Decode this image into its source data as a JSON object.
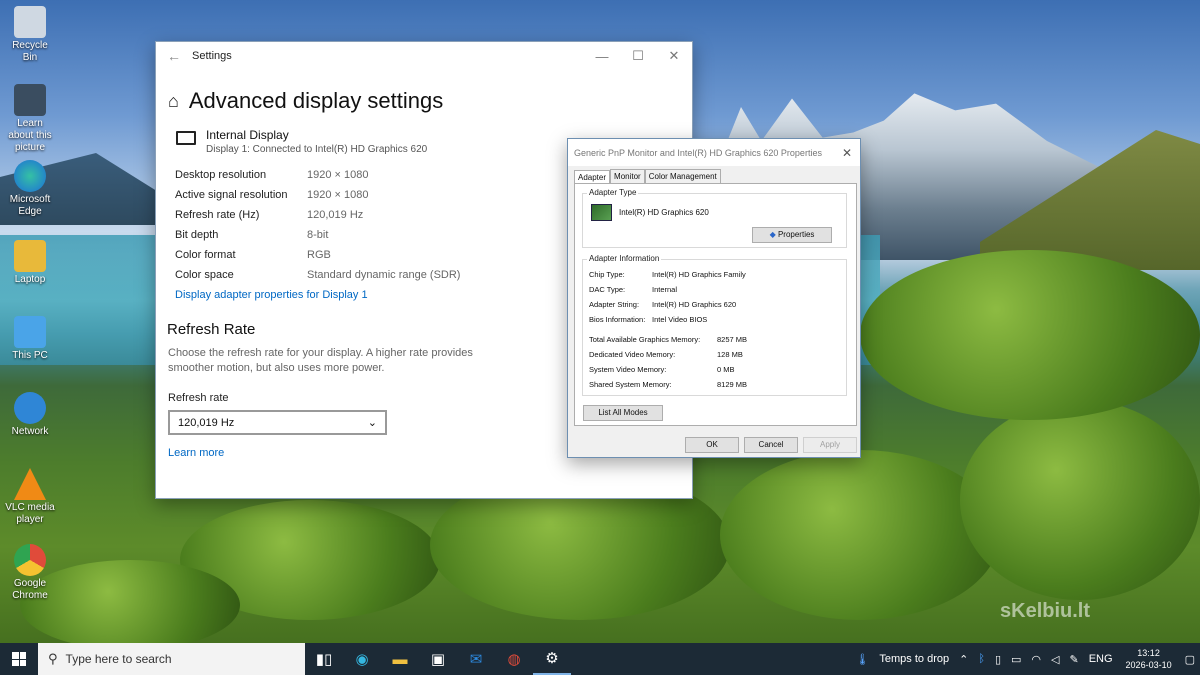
{
  "desktop": {
    "icons": [
      {
        "label": "Recycle Bin",
        "icon": "recycle-bin-icon",
        "color": "#cfd8e2"
      },
      {
        "label": "Learn about this picture",
        "icon": "learn-picture-icon",
        "color": "#3a4d60"
      },
      {
        "label": "Microsoft Edge",
        "icon": "edge-icon",
        "color": "#1c9fd9"
      },
      {
        "label": "Laptop",
        "icon": "folder-icon",
        "color": "#e8b93a"
      },
      {
        "label": "This PC",
        "icon": "this-pc-icon",
        "color": "#4aa4e8"
      },
      {
        "label": "Network",
        "icon": "network-icon",
        "color": "#2f86d6"
      },
      {
        "label": "VLC media player",
        "icon": "vlc-icon",
        "color": "#f08a15"
      },
      {
        "label": "Google Chrome",
        "icon": "chrome-icon",
        "color": "#e04b3a"
      }
    ],
    "watermark": "sKelbiu.lt"
  },
  "settings": {
    "window_title": "Settings",
    "back_glyph": "←",
    "minimize_glyph": "—",
    "maximize_glyph": "☐",
    "close_glyph": "✕",
    "heading": "Advanced display settings",
    "display_name": "Internal Display",
    "display_sub": "Display 1: Connected to Intel(R) HD Graphics 620",
    "properties": [
      {
        "key": "Desktop resolution",
        "value": "1920 × 1080"
      },
      {
        "key": "Active signal resolution",
        "value": "1920 × 1080"
      },
      {
        "key": "Refresh rate (Hz)",
        "value": "120,019 Hz"
      },
      {
        "key": "Bit depth",
        "value": "8-bit"
      },
      {
        "key": "Color format",
        "value": "RGB"
      },
      {
        "key": "Color space",
        "value": "Standard dynamic range (SDR)"
      }
    ],
    "adapter_link": "Display adapter properties for Display 1",
    "refresh_section": "Refresh Rate",
    "refresh_desc": "Choose the refresh rate for your display. A higher rate provides smoother motion, but also uses more power.",
    "refresh_label": "Refresh rate",
    "refresh_value": "120,019 Hz",
    "learn_more": "Learn more"
  },
  "dialog": {
    "title": "Generic PnP Monitor and Intel(R) HD Graphics 620 Properties",
    "close_glyph": "✕",
    "tabs": [
      "Adapter",
      "Monitor",
      "Color Management"
    ],
    "adapter_type_label": "Adapter Type",
    "adapter_name": "Intel(R) HD Graphics 620",
    "properties_button": "Properties",
    "adapter_info_label": "Adapter Information",
    "info": [
      {
        "key": "Chip Type:",
        "value": "Intel(R) HD Graphics Family"
      },
      {
        "key": "DAC Type:",
        "value": "Internal"
      },
      {
        "key": "Adapter String:",
        "value": "Intel(R) HD Graphics 620"
      },
      {
        "key": "Bios Information:",
        "value": "Intel Video BIOS"
      }
    ],
    "memory": [
      {
        "key": "Total Available Graphics Memory:",
        "value": "8257 MB"
      },
      {
        "key": "Dedicated Video Memory:",
        "value": "128 MB"
      },
      {
        "key": "System Video Memory:",
        "value": "0 MB"
      },
      {
        "key": "Shared System Memory:",
        "value": "8129 MB"
      }
    ],
    "list_modes": "List All Modes",
    "ok": "OK",
    "cancel": "Cancel",
    "apply": "Apply"
  },
  "taskbar": {
    "search_placeholder": "Type here to search",
    "weather": "Temps to drop",
    "language": "ENG",
    "time": "13:12",
    "date": "2026-03-10"
  }
}
